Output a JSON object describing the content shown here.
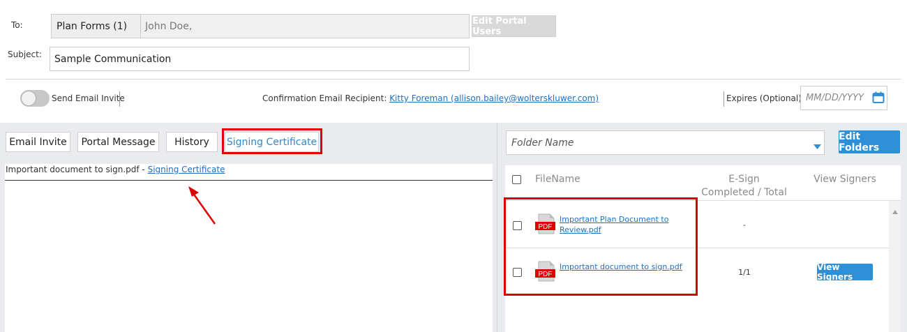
{
  "header": {
    "to_label": "To:",
    "to_group": "Plan Forms (1)",
    "to_recipients": "John Doe,",
    "edit_portal_users": "Edit Portal Users",
    "subject_label": "Subject:",
    "subject_value": "Sample Communication"
  },
  "options": {
    "send_email_invite": "Send Email Invite",
    "send_email_invite_on": false,
    "confirmation_label": "Confirmation Email Recipient:",
    "confirmation_recipient": "Kitty Foreman (allison.bailey@wolterskluwer.com)",
    "expires_label": "Expires (Optional):",
    "expires_placeholder": "MM/DD/YYYY"
  },
  "tabs": [
    {
      "label": "Email Invite"
    },
    {
      "label": "Portal Message"
    },
    {
      "label": "History"
    },
    {
      "label": "Signing Certificate",
      "active": true
    }
  ],
  "left_content": {
    "document_name": "Important document to sign.pdf - ",
    "certificate_link": "Signing Certificate"
  },
  "folders": {
    "placeholder": "Folder Name",
    "edit_button": "Edit Folders"
  },
  "files_table": {
    "columns": [
      "FileName",
      "E-Sign\nCompleted / Total",
      "View Signers"
    ],
    "col_filename": "FileName",
    "col_esign_line1": "E-Sign",
    "col_esign_line2": "Completed / Total",
    "col_viewsigners": "View Signers",
    "rows": [
      {
        "file_line1": "Important Plan Document to",
        "file_line2": "Review.pdf",
        "esign": "-",
        "view_signers": ""
      },
      {
        "file_line1": "Important document to sign.pdf",
        "file_line2": "",
        "esign": "1/1",
        "view_signers": "View Signers"
      }
    ],
    "pdf_icon_text": "PDF"
  },
  "colors": {
    "accent": "#2d8fd5",
    "highlight": "#e00000",
    "link": "#1f6fbf"
  }
}
